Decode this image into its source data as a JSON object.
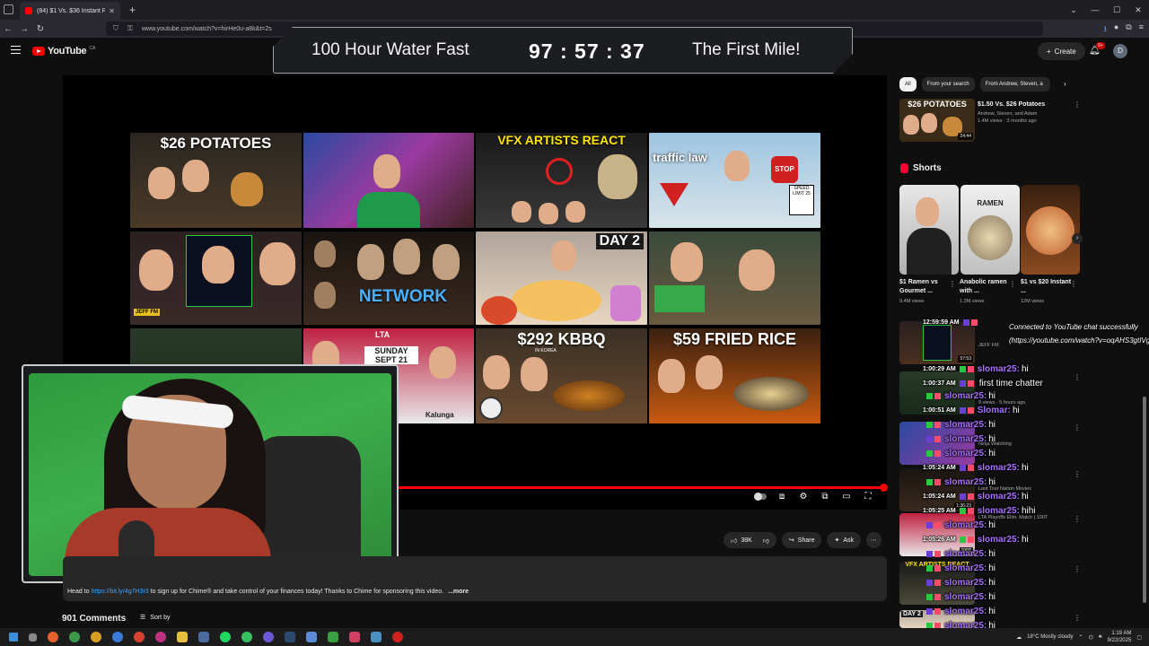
{
  "browser": {
    "tab_title": "(84) $1 Vs. $36 Instant Ramen ...",
    "url": "www.youtube.com/watch?v=hirHe0u-a8k&t=2s"
  },
  "youtube": {
    "logo": "YouTube",
    "region": "CA",
    "create_label": "Create",
    "notif_count": "9+",
    "avatar_letter": "D"
  },
  "overlay": {
    "left_text": "100 Hour Water Fast",
    "timer": "97 : 57 : 37",
    "right_text": "The First Mile!"
  },
  "endscreen": {
    "thumbs": [
      {
        "text": "$26 POTATOES"
      },
      {
        "text": ""
      },
      {
        "text": "VFX ARTISTS REACT"
      },
      {
        "text": "traffic law"
      },
      {
        "text": ""
      },
      {
        "text": "NETWORK"
      },
      {
        "text": "DAY 2"
      },
      {
        "text": ""
      },
      {
        "text": ""
      },
      {
        "text": "SUNDAY SEPT 21"
      },
      {
        "text": "$292 KBBQ"
      },
      {
        "text": "$59 FRIED RICE"
      }
    ],
    "extras": {
      "stop": "STOP",
      "speed": "SPEED LIMIT 25",
      "jeff": "JEFF FM",
      "lta": "LTA",
      "kalunga": "Kalunga",
      "korea": "IN KOREA"
    }
  },
  "player": {
    "progress_fraction": 0.992
  },
  "actions": {
    "likes": "38K",
    "share": "Share",
    "ask": "Ask"
  },
  "description": {
    "prefix": "Head to",
    "link": "https://bit.ly/4g7H3r3",
    "text": "to sign up for Chime® and take control of your finances today! Thanks to Chime for sponsoring this video.",
    "more": "...more"
  },
  "comments": {
    "count": "901 Comments",
    "sort": "Sort by"
  },
  "sidebar": {
    "chips": [
      "All",
      "From your search",
      "From Andrew, Steven, a"
    ],
    "rec1": {
      "title": "$1.50 Vs. $26 Potatoes",
      "channel": "Andrew, Steven, and Adam",
      "meta": "1.4M views · 3 months ago",
      "thumb_text": "$26 POTATOES",
      "duration": "24:44"
    },
    "shorts_title": "Shorts",
    "shorts": [
      {
        "title": "$1 Ramen vs Gourmet ...",
        "views": "9.4M views"
      },
      {
        "title": "Anabolic ramen with ...",
        "views": "1.2M views",
        "thumb_text": "RAMEN"
      },
      {
        "title": "$1 vs $20 Instant ...",
        "views": "12M views"
      }
    ],
    "list": [
      {
        "meta": "JEFF FM",
        "duration": "57:53"
      },
      {
        "meta": "9 views · 5 hours ago"
      },
      {
        "meta": "Ninja Watching"
      },
      {
        "meta": "Last Tour Nation Movies",
        "duration": "1:36:23"
      },
      {
        "meta": "LTA Playoffs Elim. Match | 100T",
        "duration": "100T"
      },
      {
        "meta": "VFX ARTISTS REACT",
        "duration": ""
      },
      {
        "meta": "DAY 2",
        "duration": ""
      }
    ]
  },
  "chat": {
    "system": "Connected to YouTube chat successfully (https://youtube.com/watch?v=oqAHS3gtIVg)",
    "lines": [
      {
        "time": "12:59:59 AM",
        "user": "",
        "msg": ""
      },
      {
        "time": "1:00:29 AM",
        "user": "slomar25:",
        "msg": "hi"
      },
      {
        "time": "1:00:37 AM",
        "user": "",
        "msg": "first time chatter"
      },
      {
        "time": "",
        "user": "slomar25:",
        "msg": "hi"
      },
      {
        "time": "1:00:51 AM",
        "user": "Slomar:",
        "msg": "hi"
      },
      {
        "time": "",
        "user": "slomar25:",
        "msg": "hi"
      },
      {
        "time": "",
        "user": "slomar25:",
        "msg": "hi"
      },
      {
        "time": "",
        "user": "slomar25:",
        "msg": "hi"
      },
      {
        "time": "1:05:24 AM",
        "user": "slomar25:",
        "msg": "hi"
      },
      {
        "time": "",
        "user": "slomar25:",
        "msg": "hi"
      },
      {
        "time": "1:05:24 AM",
        "user": "slomar25:",
        "msg": "hi"
      },
      {
        "time": "1:05:25 AM",
        "user": "slomar25:",
        "msg": "hihi"
      },
      {
        "time": "",
        "user": "slomar25:",
        "msg": "hi"
      },
      {
        "time": "1:05:26 AM",
        "user": "slomar25:",
        "msg": "hi"
      },
      {
        "time": "",
        "user": "slomar25:",
        "msg": "hi"
      },
      {
        "time": "",
        "user": "slomar25:",
        "msg": "hi"
      },
      {
        "time": "",
        "user": "slomar25:",
        "msg": "hi"
      },
      {
        "time": "",
        "user": "slomar25:",
        "msg": "hi"
      },
      {
        "time": "",
        "user": "slomar25:",
        "msg": "hi"
      },
      {
        "time": "",
        "user": "slomar25:",
        "msg": "hi"
      }
    ]
  },
  "taskbar": {
    "weather": "18°C  Mostly cloudy",
    "time": "1:19 AM",
    "date": "9/22/2025"
  },
  "colors": {
    "yt_red": "#ff0000",
    "chat_user": "#a970ff",
    "link": "#3ea6ff",
    "greenscreen": "#3eae4c"
  }
}
